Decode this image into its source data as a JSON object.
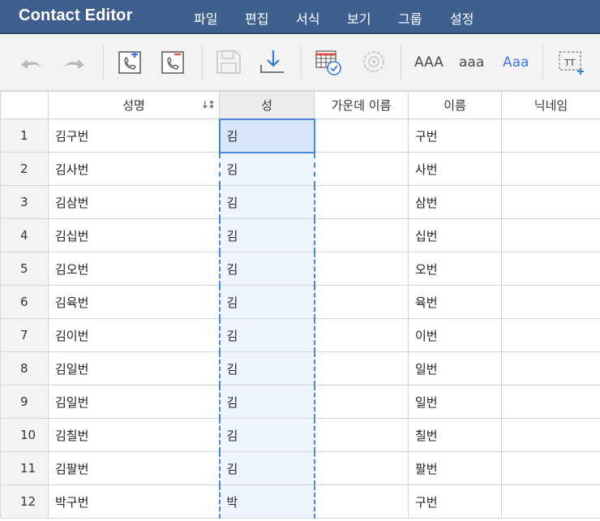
{
  "app": {
    "title": "Contact Editor"
  },
  "menu": [
    "파일",
    "편집",
    "서식",
    "보기",
    "그룹",
    "설정"
  ],
  "toolbar": {
    "case_upper": "AAA",
    "case_lower": "aaa",
    "case_title": "Aaa"
  },
  "grid": {
    "headers": {
      "full_name": "성명",
      "last_name": "성",
      "middle_name": "가운데 이름",
      "first_name": "이름",
      "nickname": "닉네임"
    },
    "rows": [
      {
        "n": "1",
        "full": "김구번",
        "last": "김",
        "middle": "",
        "first": "구번",
        "nick": ""
      },
      {
        "n": "2",
        "full": "김사번",
        "last": "김",
        "middle": "",
        "first": "사번",
        "nick": ""
      },
      {
        "n": "3",
        "full": "김삼번",
        "last": "김",
        "middle": "",
        "first": "삼번",
        "nick": ""
      },
      {
        "n": "4",
        "full": "김십번",
        "last": "김",
        "middle": "",
        "first": "십번",
        "nick": ""
      },
      {
        "n": "5",
        "full": "김오번",
        "last": "김",
        "middle": "",
        "first": "오번",
        "nick": ""
      },
      {
        "n": "6",
        "full": "김육번",
        "last": "김",
        "middle": "",
        "first": "육번",
        "nick": ""
      },
      {
        "n": "7",
        "full": "김이번",
        "last": "김",
        "middle": "",
        "first": "이번",
        "nick": ""
      },
      {
        "n": "8",
        "full": "김일번",
        "last": "김",
        "middle": "",
        "first": "일번",
        "nick": ""
      },
      {
        "n": "9",
        "full": "김일번",
        "last": "김",
        "middle": "",
        "first": "일번",
        "nick": ""
      },
      {
        "n": "10",
        "full": "김칠번",
        "last": "김",
        "middle": "",
        "first": "칠번",
        "nick": ""
      },
      {
        "n": "11",
        "full": "김팔번",
        "last": "김",
        "middle": "",
        "first": "팔번",
        "nick": ""
      },
      {
        "n": "12",
        "full": "박구번",
        "last": "박",
        "middle": "",
        "first": "구번",
        "nick": ""
      }
    ]
  },
  "colors": {
    "titlebar": "#3f5f8f",
    "selection": "#4a86d6",
    "accent_red": "#d9534f",
    "accent_blue": "#3a7bd5"
  },
  "icons": [
    "undo-icon",
    "redo-icon",
    "add-phone-icon",
    "remove-phone-icon",
    "save-icon",
    "import-icon",
    "validate-table-icon",
    "merge-icon",
    "text-size-icon"
  ]
}
